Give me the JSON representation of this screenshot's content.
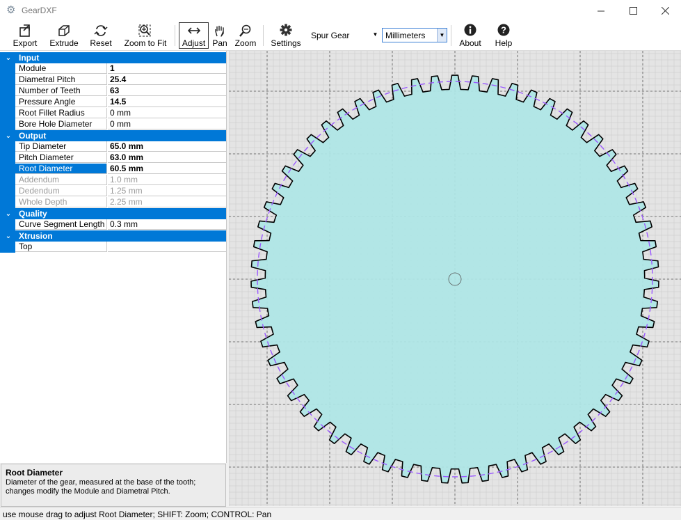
{
  "window": {
    "title": "GearDXF",
    "icon": "gear-icon",
    "controls": [
      "minimize-icon",
      "maximize-icon",
      "close-icon"
    ]
  },
  "toolbar": {
    "export": "Export",
    "extrude": "Extrude",
    "reset": "Reset",
    "zoom_to_fit": "Zoom to Fit",
    "adjust": "Adjust",
    "pan": "Pan",
    "zoom": "Zoom",
    "settings": "Settings",
    "gear_type": "Spur Gear",
    "units": "Millimeters",
    "about": "About",
    "help": "Help",
    "active_tool": "Adjust"
  },
  "properties": {
    "input": {
      "title": "Input",
      "rows": [
        {
          "name": "Module",
          "value": "1"
        },
        {
          "name": "Diametral Pitch",
          "value": "25.4"
        },
        {
          "name": "Number of Teeth",
          "value": "63"
        },
        {
          "name": "Pressure Angle",
          "value": "14.5"
        },
        {
          "name": "Root Fillet Radius",
          "value": "0 mm"
        },
        {
          "name": "Bore Hole Diameter",
          "value": "0 mm"
        }
      ]
    },
    "output": {
      "title": "Output",
      "rows": [
        {
          "name": "Tip Diameter",
          "value": "65.0 mm"
        },
        {
          "name": "Pitch Diameter",
          "value": "63.0 mm"
        },
        {
          "name": "Root Diameter",
          "value": "60.5 mm"
        },
        {
          "name": "Addendum",
          "value": "1.0 mm"
        },
        {
          "name": "Dedendum",
          "value": "1.25 mm"
        },
        {
          "name": "Whole Depth",
          "value": "2.25 mm"
        }
      ]
    },
    "quality": {
      "title": "Quality",
      "rows": [
        {
          "name": "Curve Segment Length",
          "value": "0.3 mm"
        }
      ]
    },
    "xtrusion": {
      "title": "Xtrusion",
      "rows": [
        {
          "name": "Top",
          "value": ""
        }
      ]
    },
    "selected": "Root Diameter"
  },
  "help": {
    "title": "Root Diameter",
    "text": "Diameter of the gear, measured at the base of the tooth; changes modify the Module and Diametral Pitch."
  },
  "status": {
    "text": "use mouse drag to adjust Root Diameter; SHIFT: Zoom; CONTROL: Pan"
  },
  "gear": {
    "teeth": 63,
    "tip_diameter_mm": 65.0,
    "pitch_diameter_mm": 63.0,
    "root_diameter_mm": 60.5,
    "pressure_angle_deg": 14.5,
    "fill_color": "#aee6e6",
    "outline_color": "#000000",
    "pitch_circle_color": "#9b59ff",
    "grid_color": "#c0c0c0",
    "canvas_color": "#e4e4e4"
  },
  "colors": {
    "accent": "#0078d7"
  }
}
